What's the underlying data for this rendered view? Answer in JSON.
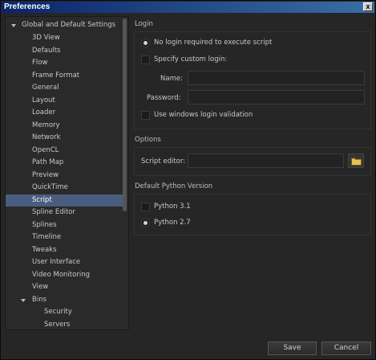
{
  "window": {
    "title": "Preferences",
    "close_glyph": "x"
  },
  "tree": {
    "root_label": "Global and Default Settings",
    "items": [
      {
        "label": "3D View"
      },
      {
        "label": "Defaults"
      },
      {
        "label": "Flow"
      },
      {
        "label": "Frame Format"
      },
      {
        "label": "General"
      },
      {
        "label": "Layout"
      },
      {
        "label": "Loader"
      },
      {
        "label": "Memory"
      },
      {
        "label": "Network"
      },
      {
        "label": "OpenCL"
      },
      {
        "label": "Path Map"
      },
      {
        "label": "Preview"
      },
      {
        "label": "QuickTime"
      },
      {
        "label": "Script",
        "selected": true
      },
      {
        "label": "Spline Editor"
      },
      {
        "label": "Splines"
      },
      {
        "label": "Timeline"
      },
      {
        "label": "Tweaks"
      },
      {
        "label": "User Interface"
      },
      {
        "label": "Video Monitoring"
      },
      {
        "label": "View"
      }
    ],
    "bins_label": "Bins",
    "bins_items": [
      {
        "label": "Security"
      },
      {
        "label": "Servers"
      }
    ]
  },
  "login": {
    "title": "Login",
    "no_login_label": "No login required to execute script",
    "custom_login_label": "Specify custom login:",
    "name_label": "Name:",
    "name_value": "",
    "password_label": "Password:",
    "password_value": "",
    "windows_login_label": "Use windows login validation"
  },
  "options": {
    "title": "Options",
    "script_editor_label": "Script editor:",
    "script_editor_value": ""
  },
  "python": {
    "title": "Default Python Version",
    "py3_label": "Python 3.1",
    "py2_label": "Python 2.7",
    "selected": "Python 2.7"
  },
  "footer": {
    "save_label": "Save",
    "cancel_label": "Cancel"
  },
  "colors": {
    "selection": "#4a5d80",
    "titlebar": "#0a246a",
    "background": "#262626"
  }
}
